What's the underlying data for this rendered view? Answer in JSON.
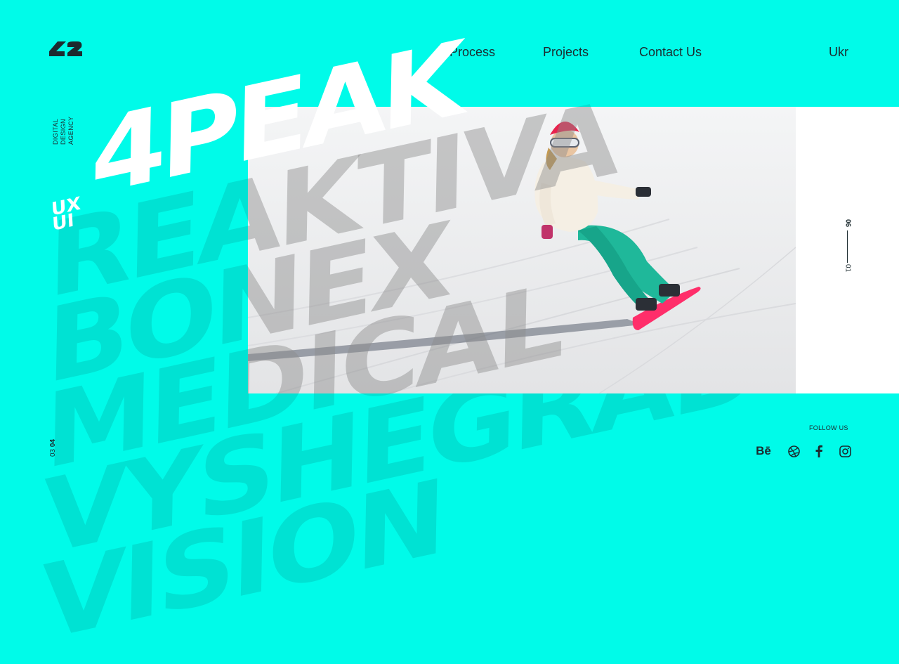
{
  "brand": {
    "logo_text": "42"
  },
  "nav": {
    "items": [
      {
        "label": "Process"
      },
      {
        "label": "Projects"
      },
      {
        "label": "Contact Us"
      }
    ],
    "language": "Ukr"
  },
  "tagline": [
    "DIGITAL",
    "DESIGN",
    "AGENCY"
  ],
  "hero": {
    "tag_line1": "UX",
    "tag_line2": "UI",
    "title": "4PEAK"
  },
  "background_words": [
    "REAKTIVA",
    "BONEX",
    "MEDICAL",
    "VYSHEGRAD",
    "VISION"
  ],
  "slider": {
    "current": "01",
    "total": "06"
  },
  "slider_bottom": {
    "current": "03",
    "total": "04"
  },
  "follow": {
    "label": "FOLLOW US",
    "links": [
      {
        "name": "behance-icon",
        "label": "Bē"
      },
      {
        "name": "dribbble-icon"
      },
      {
        "name": "facebook-icon"
      },
      {
        "name": "instagram-icon"
      }
    ]
  },
  "colors": {
    "background": "#00fbe9",
    "text": "#1c2b2f",
    "hero_text": "#ffffff",
    "ghost_text": "#00e2d3"
  }
}
